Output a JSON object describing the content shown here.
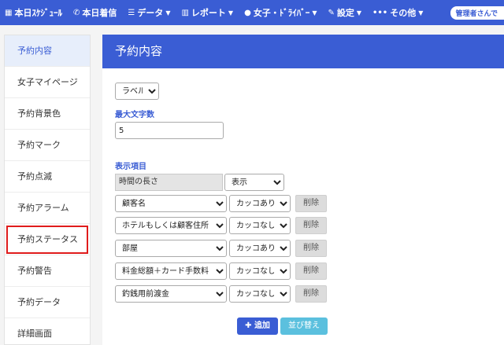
{
  "nav": {
    "items": [
      {
        "icon": "calendar-icon",
        "glyph": "▦",
        "label": "本日ｽｹｼﾞｭｰﾙ",
        "caret": false
      },
      {
        "icon": "phone-icon",
        "glyph": "✆",
        "label": "本日着信",
        "caret": false
      },
      {
        "icon": "database-icon",
        "glyph": "☰",
        "label": "データ",
        "caret": true
      },
      {
        "icon": "chart-icon",
        "glyph": "▥",
        "label": "レポート",
        "caret": true
      },
      {
        "icon": "user-icon",
        "glyph": "●",
        "label": "女子・ﾄﾞﾗｲﾊﾞｰ",
        "caret": true
      },
      {
        "icon": "wrench-icon",
        "glyph": "✎",
        "label": "設定",
        "caret": true
      },
      {
        "icon": "more-icon",
        "glyph": "•••",
        "label": "その他",
        "caret": true
      }
    ],
    "user_badge": "管理者さんで"
  },
  "sidebar": {
    "items": [
      {
        "label": "予約内容"
      },
      {
        "label": "女子マイページ"
      },
      {
        "label": "予約背景色"
      },
      {
        "label": "予約マーク"
      },
      {
        "label": "予約点滅"
      },
      {
        "label": "予約アラーム"
      },
      {
        "label": "予約ステータス"
      },
      {
        "label": "予約警告"
      },
      {
        "label": "予約データ"
      },
      {
        "label": "詳細画面"
      }
    ],
    "active_index": 0,
    "highlight_index": 6
  },
  "panel": {
    "title": "予約内容",
    "type_select": "ラベル",
    "max_chars_label": "最大文字数",
    "max_chars_value": "5",
    "items_label": "表示項目",
    "fixed_row": {
      "field": "時間の長さ",
      "option": "表示"
    },
    "rows": [
      {
        "field": "顧客名",
        "option": "カッコあり",
        "delete": "削除"
      },
      {
        "field": "ホテルもしくは顧客住所",
        "option": "カッコなし",
        "delete": "削除"
      },
      {
        "field": "部屋",
        "option": "カッコあり",
        "delete": "削除"
      },
      {
        "field": "料金総額＋カード手数料",
        "option": "カッコなし",
        "delete": "削除"
      },
      {
        "field": "釣銭用前渡金",
        "option": "カッコなし",
        "delete": "削除"
      }
    ],
    "add_label": "追加",
    "sort_label": "並び替え"
  },
  "colors": {
    "primary": "#3a5dd4",
    "info": "#5bc0de",
    "highlight": "#e01c1c"
  }
}
